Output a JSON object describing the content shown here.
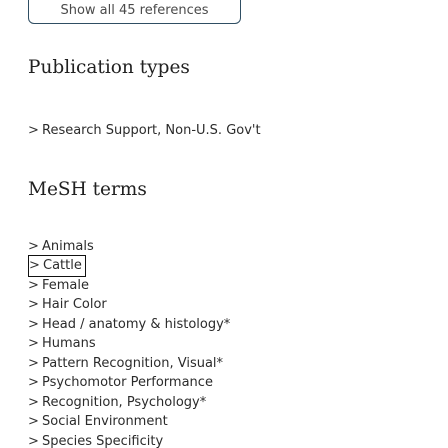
{
  "show_all_button": {
    "label": "Show all 45 references"
  },
  "publication_types": {
    "title": "Publication types",
    "items": [
      {
        "label": "Research Support, Non-U.S. Gov't"
      }
    ]
  },
  "mesh_terms": {
    "title": "MeSH terms",
    "items": [
      {
        "label": "Animals"
      },
      {
        "label": "Cattle",
        "focused": true
      },
      {
        "label": "Female"
      },
      {
        "label": "Hair Color"
      },
      {
        "label": "Head / anatomy & histology*"
      },
      {
        "label": "Humans"
      },
      {
        "label": "Pattern Recognition, Visual*"
      },
      {
        "label": "Psychomotor Performance"
      },
      {
        "label": "Recognition, Psychology*"
      },
      {
        "label": "Social Environment"
      },
      {
        "label": "Species Specificity"
      }
    ]
  },
  "icons": {
    "expand": "chevron-right-icon"
  },
  "colors": {
    "button_border": "#2f4e63",
    "text": "#2b2b2b",
    "title": "#212121"
  }
}
